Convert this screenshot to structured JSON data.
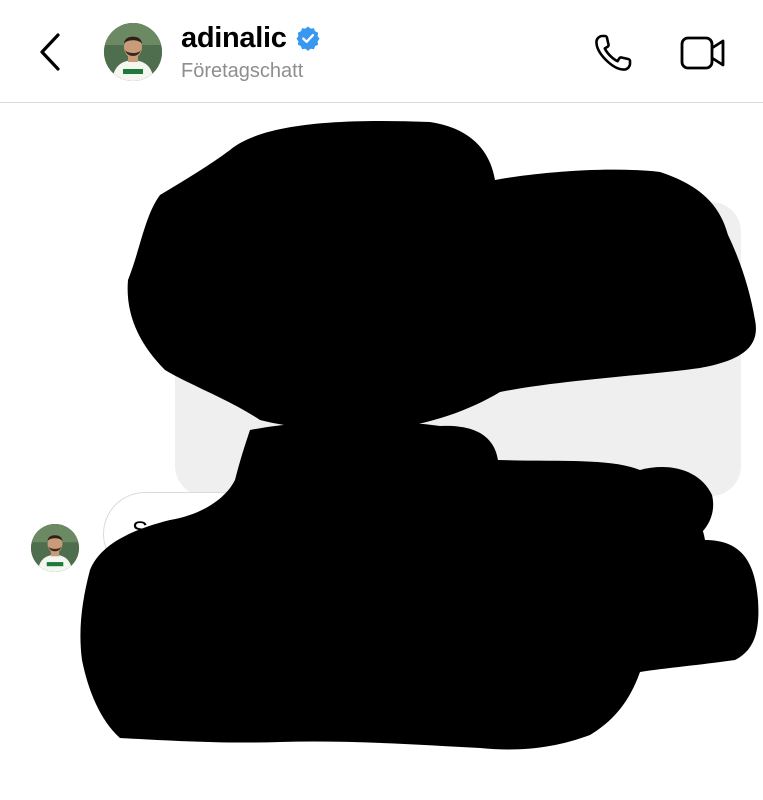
{
  "header": {
    "back_icon": "chevron-left-icon",
    "username": "adinalic",
    "verified_icon": "verified-badge-icon",
    "subtitle": "Företagschatt",
    "call_icon": "phone-icon",
    "video_icon": "video-camera-icon"
  },
  "conversation": {
    "incoming_message": {
      "text_visible": "S"
    }
  },
  "colors": {
    "verified_blue": "#3897f0",
    "subtitle_gray": "#8e8e8e",
    "divider": "#dbdbdb",
    "outgoing_bubble": "#efefef",
    "redaction": "#000000"
  }
}
